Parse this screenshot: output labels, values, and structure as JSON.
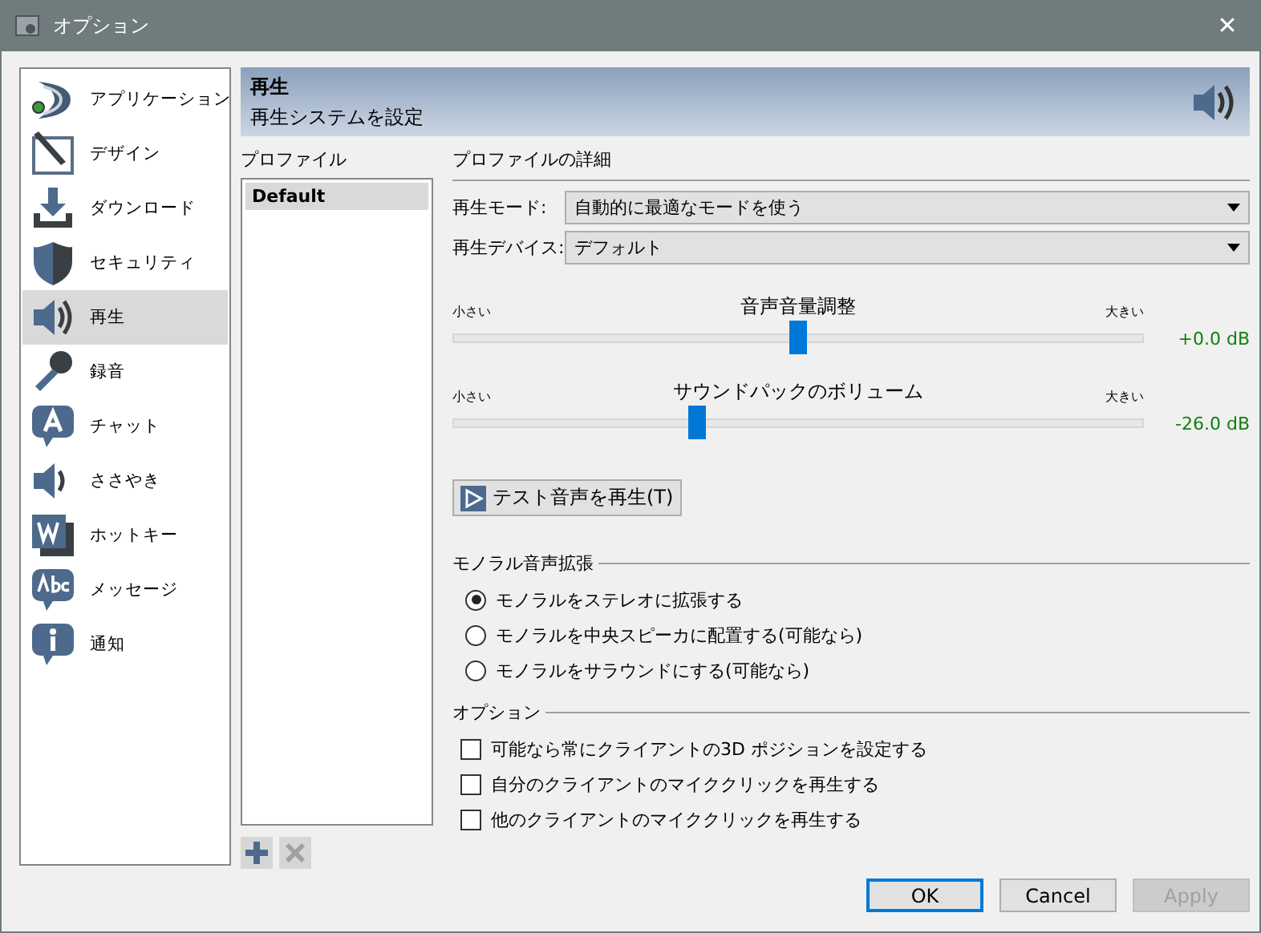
{
  "window": {
    "title": "オプション",
    "close": "✕"
  },
  "sidebar": {
    "items": [
      {
        "label": "アプリケーション",
        "selected": false
      },
      {
        "label": "デザイン",
        "selected": false
      },
      {
        "label": "ダウンロード",
        "selected": false
      },
      {
        "label": "セキュリティ",
        "selected": false
      },
      {
        "label": "再生",
        "selected": true
      },
      {
        "label": "録音",
        "selected": false
      },
      {
        "label": "チャット",
        "selected": false
      },
      {
        "label": "ささやき",
        "selected": false
      },
      {
        "label": "ホットキー",
        "selected": false
      },
      {
        "label": "メッセージ",
        "selected": false
      },
      {
        "label": "通知",
        "selected": false
      }
    ]
  },
  "header": {
    "title": "再生",
    "subtitle": "再生システムを設定"
  },
  "profiles": {
    "label": "プロファイル",
    "items": [
      {
        "label": "Default",
        "selected": true
      }
    ],
    "remove_disabled": true
  },
  "details": {
    "label": "プロファイルの詳細",
    "fields": [
      {
        "label": "再生モード:",
        "value": "自動的に最適なモードを使う"
      },
      {
        "label": "再生デバイス:",
        "value": "デフォルト"
      }
    ],
    "sliders": [
      {
        "title": "音声音量調整",
        "min_label": "小さい",
        "max_label": "大きい",
        "level": 0.5,
        "reading": "+0.0 dB"
      },
      {
        "title": "サウンドパックのボリューム",
        "min_label": "小さい",
        "max_label": "大きい",
        "level": 0.354,
        "reading": "-26.0 dB"
      }
    ],
    "test_button": "テスト音声を再生(T)"
  },
  "mono": {
    "label": "モノラル音声拡張",
    "options": [
      {
        "label": "モノラルをステレオに拡張する",
        "selected": true
      },
      {
        "label": "モノラルを中央スピーカに配置する(可能なら)",
        "selected": false
      },
      {
        "label": "モノラルをサラウンドにする(可能なら)",
        "selected": false
      }
    ]
  },
  "options": {
    "label": "オプション",
    "items": [
      {
        "label": "可能なら常にクライアントの3D ポジションを設定する",
        "checked": false
      },
      {
        "label": "自分のクライアントのマイククリックを再生する",
        "checked": false
      },
      {
        "label": "他のクライアントのマイククリックを再生する",
        "checked": false
      }
    ]
  },
  "buttons": [
    {
      "label": "OK",
      "default": true,
      "disabled": false
    },
    {
      "label": "Cancel",
      "default": false,
      "disabled": false
    },
    {
      "label": "Apply",
      "default": false,
      "disabled": true
    }
  ]
}
